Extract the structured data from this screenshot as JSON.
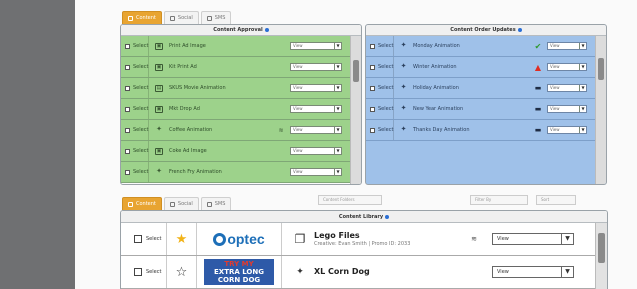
{
  "top_tabs": [
    {
      "label": "Content",
      "icon": "content-icon"
    },
    {
      "label": "Social",
      "icon": "social-icon"
    },
    {
      "label": "SMS",
      "icon": "sms-icon"
    }
  ],
  "approval": {
    "title": "Content Approval",
    "rows": [
      {
        "select": "Select",
        "name": "Print Ad Image",
        "value": "View"
      },
      {
        "select": "Select",
        "name": "Kit Print Ad",
        "value": "View"
      },
      {
        "select": "Select",
        "name": "SKUS Movie Animation",
        "value": "View"
      },
      {
        "select": "Select",
        "name": "Mkt Drop Ad",
        "value": "View"
      },
      {
        "select": "Select",
        "name": "Coffee Animation",
        "value": "View"
      },
      {
        "select": "Select",
        "name": "Coke Ad Image",
        "value": "View"
      },
      {
        "select": "Select",
        "name": "French Fry Animation",
        "value": "View"
      }
    ]
  },
  "order_updates": {
    "title": "Content Order Updates",
    "rows": [
      {
        "select": "Select",
        "name": "Monday Animation",
        "status": "check",
        "value": "View"
      },
      {
        "select": "Select",
        "name": "Winter Animation",
        "status": "warning",
        "value": "View"
      },
      {
        "select": "Select",
        "name": "Holiday Animation",
        "status": "truck",
        "value": "View"
      },
      {
        "select": "Select",
        "name": "New Year Animation",
        "status": "truck",
        "value": "View"
      },
      {
        "select": "Select",
        "name": "Thanks Day Animation",
        "status": "truck",
        "value": "View"
      }
    ]
  },
  "bottom_tabs": [
    {
      "label": "Content"
    },
    {
      "label": "Social"
    },
    {
      "label": "SMS"
    }
  ],
  "filters": {
    "content_folders": "Content Folders",
    "filter_by": "Filter By",
    "sort": "Sort"
  },
  "library": {
    "title": "Content Library",
    "rows": [
      {
        "select": "Select",
        "favorite": true,
        "brand": "optec",
        "title": "Lego Files",
        "subtitle": "Creative: Evan Smith | Promo ID: 2033",
        "value": "View"
      },
      {
        "select": "Select",
        "favorite": false,
        "brand_lines": [
          "TRY MY",
          "EXTRA LONG",
          "CORN DOG"
        ],
        "title": "XL Corn Dog",
        "subtitle": "",
        "value": "View"
      }
    ]
  },
  "colors": {
    "accent_tab": "#e8a431",
    "approval_green": "#9dd28b",
    "updates_blue": "#9fc1e9",
    "status_check": "#2f9a2f",
    "status_warning": "#e02d22",
    "brand_blue": "#1d6fb8"
  }
}
